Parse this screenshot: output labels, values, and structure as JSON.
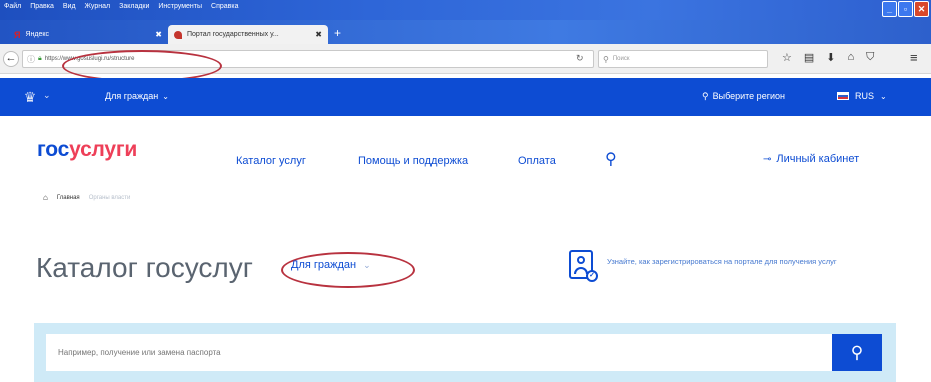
{
  "menu": [
    "Файл",
    "Правка",
    "Вид",
    "Журнал",
    "Закладки",
    "Инструменты",
    "Справка"
  ],
  "tabs": [
    {
      "label": "Яндекс",
      "close": "✖"
    },
    {
      "label": "Портал государственных у...",
      "close": "✖"
    }
  ],
  "new_tab_icon": "+",
  "address": {
    "url": "https://www.gosuslugi.ru/structure"
  },
  "search_bar": {
    "placeholder": "Поиск",
    "icon": "magnifier-icon"
  },
  "toolbar_icons": [
    "star-icon",
    "library-icon",
    "download-icon",
    "home-icon",
    "pocket-icon"
  ],
  "site": {
    "audience_selector": "Для граждан",
    "region": "Выберите регион",
    "language": "RUS",
    "logo_part1": "гос",
    "logo_part2": "услуги",
    "nav": [
      "Каталог услуг",
      "Помощь и поддержка",
      "Оплата"
    ],
    "cabinet": "Личный кабинет",
    "breadcrumbs": [
      "Главная",
      "Органы власти"
    ],
    "headline": "Каталог госуслуг",
    "audience_chip": "Для граждан",
    "register_hint": "Узнайте, как зарегистрироваться на портале для получения услуг",
    "search_placeholder": "Например, получение или замена паспорта"
  },
  "colors": {
    "brand_blue": "#0d4cd3",
    "brand_red": "#ee3f58",
    "search_band": "#cfeaf7",
    "annotation_red": "#b8323f"
  }
}
